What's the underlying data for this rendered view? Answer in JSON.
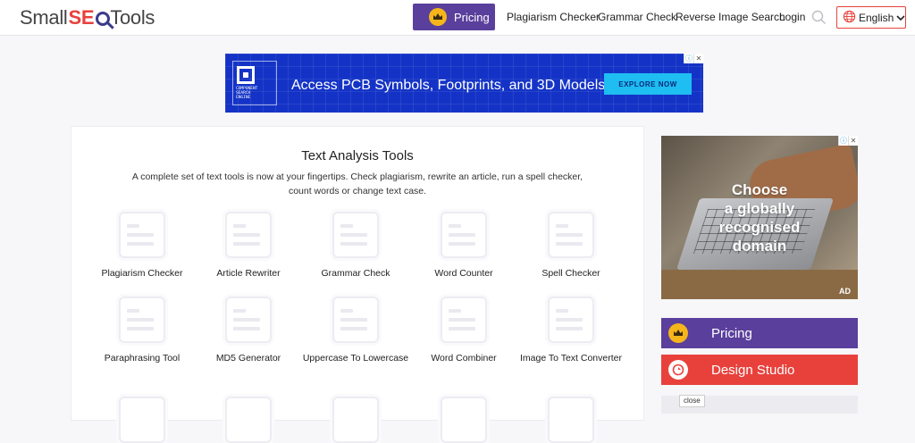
{
  "logo": {
    "part1": "Small",
    "part2": "SE",
    "part3": "Tools"
  },
  "header": {
    "pricing_label": "Pricing",
    "nav": [
      "Plagiarism Checker",
      "Grammar Check",
      "Reverse Image Search",
      "Login"
    ],
    "language": "English"
  },
  "top_ad": {
    "logo_text": [
      "COMPONENT",
      "SEARCH",
      "ENGINE"
    ],
    "headline": "Access PCB Symbols, Footprints, and 3D Models",
    "cta": "EXPLORE NOW"
  },
  "main": {
    "title": "Text Analysis Tools",
    "description": "A complete set of text tools is now at your fingertips. Check plagiarism, rewrite an article, run a spell checker, count words or change text case.",
    "tools": [
      {
        "label": "Plagiarism Checker"
      },
      {
        "label": "Article Rewriter"
      },
      {
        "label": "Grammar Check"
      },
      {
        "label": "Word Counter"
      },
      {
        "label": "Spell Checker"
      },
      {
        "label": "Paraphrasing Tool"
      },
      {
        "label": "MD5 Generator"
      },
      {
        "label": "Uppercase To Lowercase"
      },
      {
        "label": "Word Combiner"
      },
      {
        "label": "Image To Text Converter"
      }
    ]
  },
  "side_ad": {
    "lines": [
      "Choose",
      "a globally",
      "recognised",
      "domain"
    ],
    "tag": "AD"
  },
  "sidebar": {
    "pricing_label": "Pricing",
    "design_label": "Design Studio",
    "close_label": "close"
  },
  "colors": {
    "brand_purple": "#5a3f9c",
    "brand_red": "#e8413c",
    "crown_yellow": "#f5b51b",
    "ad_blue": "#1433c6",
    "cta_cyan": "#1ebdf2"
  }
}
